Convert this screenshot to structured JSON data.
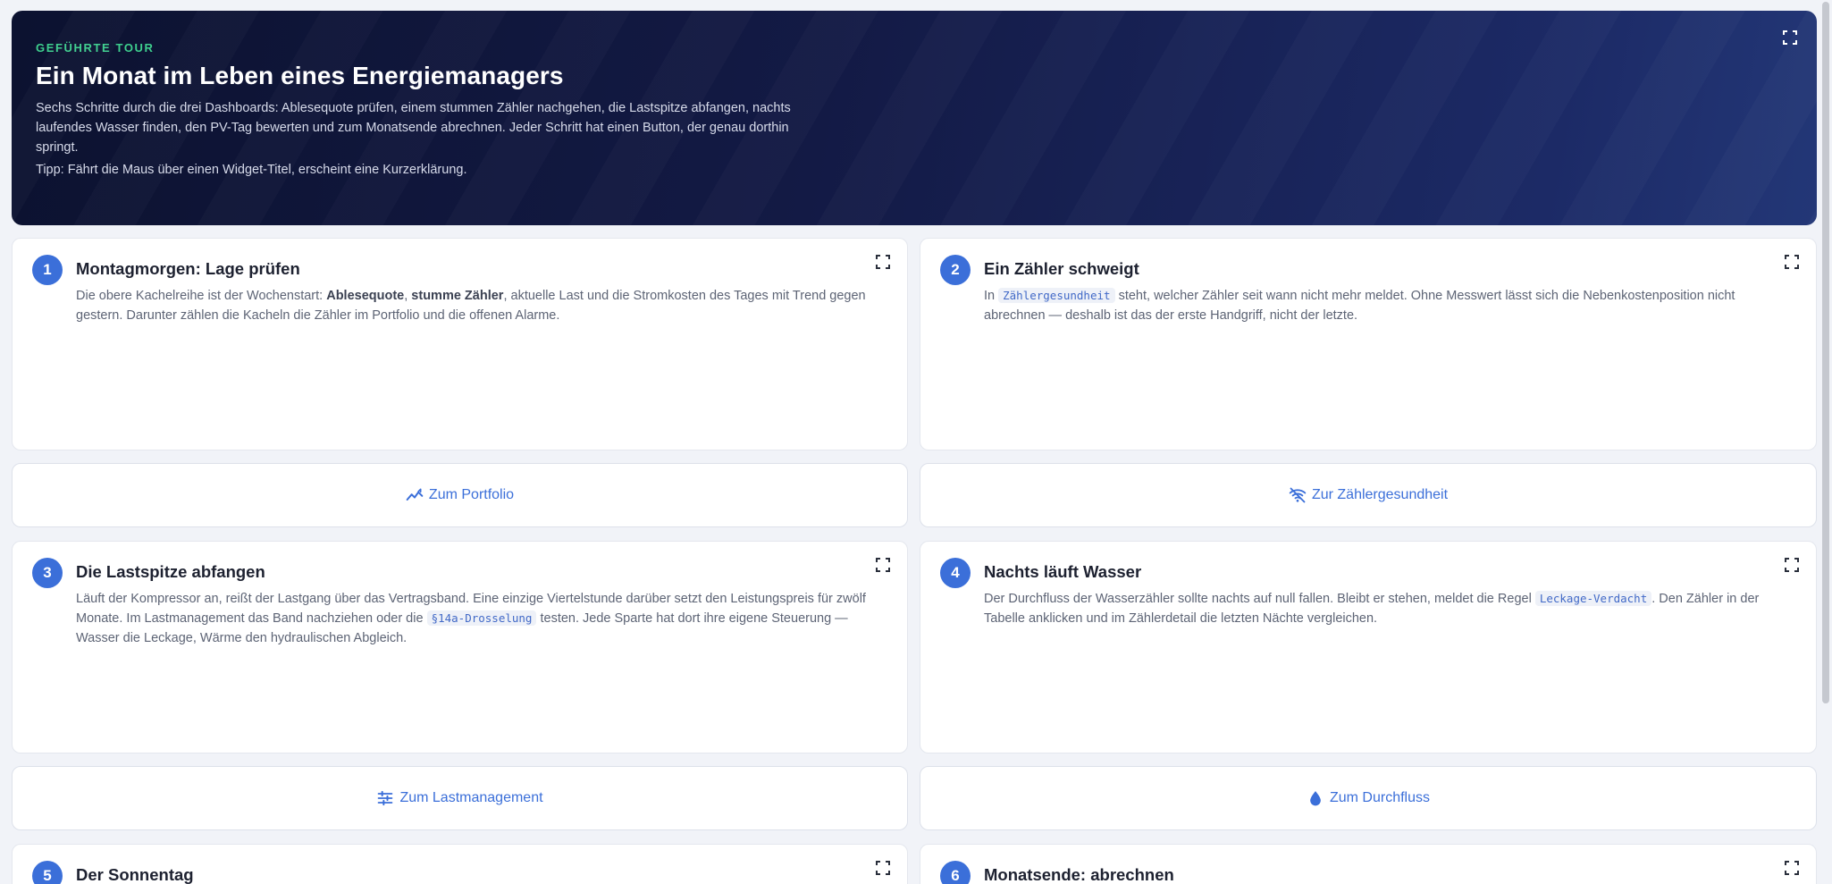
{
  "hero": {
    "eyebrow": "GEFÜHRTE TOUR",
    "title": "Ein Monat im Leben eines Energiemanagers",
    "description": "Sechs Schritte durch die drei Dashboards: Ablesequote prüfen, einem stummen Zähler nachgehen, die Lastspitze abfangen, nachts laufendes Wasser finden, den PV-Tag bewerten und zum Monatsende abrechnen. Jeder Schritt hat einen Button, der genau dorthin springt.",
    "tip": "Tipp: Fährt die Maus über einen Widget-Titel, erscheint eine Kurzerklärung."
  },
  "steps": [
    {
      "number": "1",
      "title": "Montagmorgen: Lage prüfen",
      "text_a": "Die obere Kachelreihe ist der Wochenstart: ",
      "bold_a": "Ablesequote",
      "text_b": ", ",
      "bold_b": "stumme Zähler",
      "text_c": ", aktuelle Last und die Stromkosten des Tages mit Trend gegen gestern. Darunter zählen die Kacheln die Zähler im Portfolio und die offenen Alarme.",
      "button": "Zum Portfolio",
      "button_icon": "trending-icon"
    },
    {
      "number": "2",
      "title": "Ein Zähler schweigt",
      "text_a": "In ",
      "code": "Zählergesundheit",
      "text_b": " steht, welcher Zähler seit wann nicht mehr meldet. Ohne Messwert lässt sich die Nebenkostenposition nicht abrechnen — deshalb ist das der erste Handgriff, nicht der letzte.",
      "button": "Zur Zählergesundheit",
      "button_icon": "wifi-off-icon"
    },
    {
      "number": "3",
      "title": "Die Lastspitze abfangen",
      "text_a": "Läuft der Kompressor an, reißt der Lastgang über das Vertragsband. Eine einzige Viertelstunde darüber setzt den Leistungspreis für zwölf Monate. Im Lastmanagement das Band nachziehen oder die ",
      "code": "§14a-Drosselung",
      "text_b": " testen. Jede Sparte hat dort ihre eigene Steuerung — Wasser die Leckage, Wärme den hydraulischen Abgleich.",
      "button": "Zum Lastmanagement",
      "button_icon": "sliders-icon"
    },
    {
      "number": "4",
      "title": "Nachts läuft Wasser",
      "text_a": "Der Durchfluss der Wasserzähler sollte nachts auf null fallen. Bleibt er stehen, meldet die Regel ",
      "code": "Leckage-Verdacht",
      "text_b": ". Den Zähler in der Tabelle anklicken und im Zählerdetail die letzten Nächte vergleichen.",
      "button": "Zum Durchfluss",
      "button_icon": "water-drop-icon"
    },
    {
      "number": "5",
      "title": "Der Sonnentag"
    },
    {
      "number": "6",
      "title": "Monatsende: abrechnen"
    }
  ]
}
